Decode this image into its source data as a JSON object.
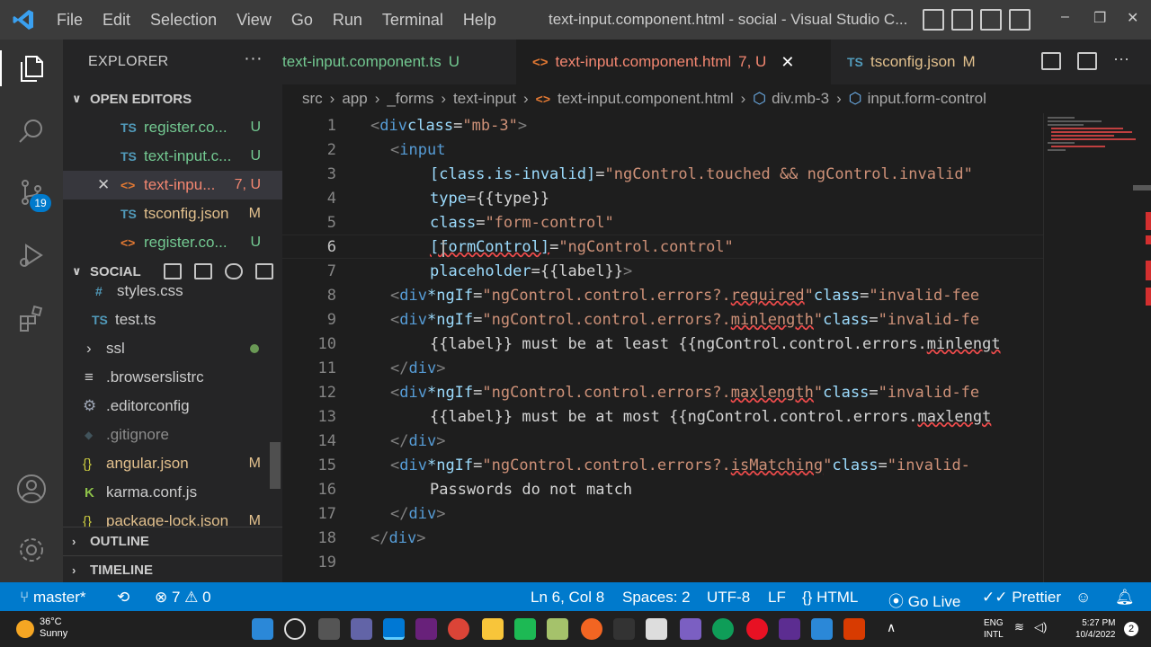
{
  "titlebar": {
    "menu": [
      "File",
      "Edit",
      "Selection",
      "View",
      "Go",
      "Run",
      "Terminal",
      "Help"
    ],
    "window_title": "text-input.component.html - social - Visual Studio C...",
    "controls": [
      "–",
      "❐",
      "✕"
    ]
  },
  "activity": {
    "source_control_badge": "19"
  },
  "sidebar": {
    "title": "EXPLORER",
    "more": "···",
    "open_editors": {
      "label": "OPEN EDITORS",
      "items": [
        {
          "type": "TS",
          "name": "register.co...",
          "status": "U"
        },
        {
          "type": "TS",
          "name": "text-input.c...",
          "status": "U"
        },
        {
          "type": "<>",
          "name": "text-inpu...",
          "status": "7, U",
          "close": "✕"
        },
        {
          "type": "TS",
          "name": "tsconfig.json",
          "status": "M"
        },
        {
          "type": "<>",
          "name": "register.co...",
          "status": "U"
        }
      ]
    },
    "project": {
      "label": "SOCIAL",
      "items": [
        {
          "type": "#",
          "name": "styles.css",
          "status": ""
        },
        {
          "type": "TS",
          "name": "test.ts",
          "status": ""
        },
        {
          "type": "›",
          "name": "ssl",
          "status": ""
        },
        {
          "type": "≡",
          "name": ".browserslistrc",
          "status": ""
        },
        {
          "type": "⚙",
          "name": ".editorconfig",
          "status": ""
        },
        {
          "type": "◆",
          "name": ".gitignore",
          "status": ""
        },
        {
          "type": "{}",
          "name": "angular.json",
          "status": "M"
        },
        {
          "type": "K",
          "name": "karma.conf.js",
          "status": ""
        },
        {
          "type": "{}",
          "name": "package-lock.json",
          "status": "M"
        }
      ]
    },
    "outline": "OUTLINE",
    "timeline": "TIMELINE"
  },
  "tabs": [
    {
      "name": "text-input.component.ts",
      "status": "U",
      "active": false
    },
    {
      "name": "text-input.component.html",
      "status": "7, U",
      "active": true,
      "close": "✕"
    },
    {
      "name": "tsconfig.json",
      "status": "M",
      "active": false
    }
  ],
  "breadcrumb": [
    "src",
    "app",
    "_forms",
    "text-input",
    "text-input.component.html",
    "div.mb-3",
    "input.form-control"
  ],
  "editor": {
    "current_line": 6,
    "line_numbers": [
      "1",
      "2",
      "3",
      "4",
      "5",
      "6",
      "7",
      "8",
      "9",
      "10",
      "11",
      "12",
      "13",
      "14",
      "15",
      "16",
      "17",
      "18",
      "19"
    ]
  },
  "statusbar": {
    "branch": "master*",
    "errors": "7",
    "warnings": "0",
    "position": "Ln 6, Col 8",
    "spaces": "Spaces: 2",
    "encoding": "UTF-8",
    "eol": "LF",
    "language": "HTML",
    "golive": "Go Live",
    "prettier": "Prettier"
  },
  "taskbar": {
    "temperature": "36°C",
    "weather": "Sunny",
    "lang_top": "ENG",
    "lang_bottom": "INTL",
    "time": "5:27 PM",
    "date": "10/4/2022",
    "notif_count": "2"
  },
  "colors": {
    "accent": "#007acc",
    "titlebar": "#3c3c3c",
    "sidebar": "#252526",
    "editor": "#1e1e1e"
  }
}
